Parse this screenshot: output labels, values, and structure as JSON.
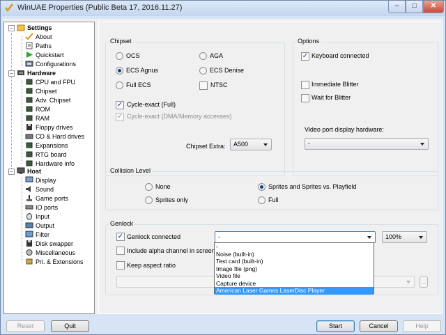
{
  "window": {
    "title": "WinUAE Properties (Public Beta 17, 2016.11.27)",
    "minimize": "–",
    "maximize": "□",
    "close": "✕"
  },
  "tree": {
    "settings": "Settings",
    "items_settings": [
      "About",
      "Paths",
      "Quickstart",
      "Configurations"
    ],
    "hardware": "Hardware",
    "items_hardware": [
      "CPU and FPU",
      "Chipset",
      "Adv. Chipset",
      "ROM",
      "RAM",
      "Floppy drives",
      "CD & Hard drives",
      "Expansions",
      "RTG board",
      "Hardware info"
    ],
    "host": "Host",
    "items_host": [
      "Display",
      "Sound",
      "Game ports",
      "IO ports",
      "Input",
      "Output",
      "Filter",
      "Disk swapper",
      "Miscellaneous",
      "Pri. & Extensions"
    ]
  },
  "chipset": {
    "title": "Chipset",
    "ocs": "OCS",
    "aga": "AGA",
    "ecs_agnus": "ECS Agnus",
    "ecs_denise": "ECS Denise",
    "full_ecs": "Full ECS",
    "ntsc": "NTSC",
    "cycle_exact_full": "Cycle-exact (Full)",
    "cycle_exact_dma": "Cycle-exact (DMA/Memory accesses)",
    "chipset_extra_label": "Chipset Extra:",
    "chipset_extra_value": "A500",
    "selected": "ECS Agnus"
  },
  "options": {
    "title": "Options",
    "keyboard_connected": "Keyboard connected",
    "immediate_blitter": "Immediate Blitter",
    "wait_for_blitter": "Wait for Blitter",
    "video_port_label": "Video port display hardware:",
    "video_port_value": "-"
  },
  "collision": {
    "title": "Collision Level",
    "none": "None",
    "sprites_playfield": "Sprites and Sprites vs. Playfield",
    "sprites_only": "Sprites only",
    "full": "Full"
  },
  "genlock": {
    "title": "Genlock",
    "genlock_connected": "Genlock connected",
    "include_alpha": "Include alpha channel in screen",
    "keep_aspect": "Keep aspect ratio",
    "mode_value": "-",
    "percent_value": "100%",
    "file_browse": "...",
    "options": [
      "-",
      "Noise (built-in)",
      "Test card (built-in)",
      "Image file (png)",
      "Video file",
      "Capture device",
      "American Laser Games LaserDisc Player"
    ]
  },
  "buttons": {
    "reset": "Reset",
    "quit": "Quit",
    "start": "Start",
    "cancel": "Cancel",
    "help": "Help"
  },
  "colors": {
    "titlebar": "#c4d6ee",
    "selection": "#3399ff",
    "panel": "#f0f0f0"
  }
}
